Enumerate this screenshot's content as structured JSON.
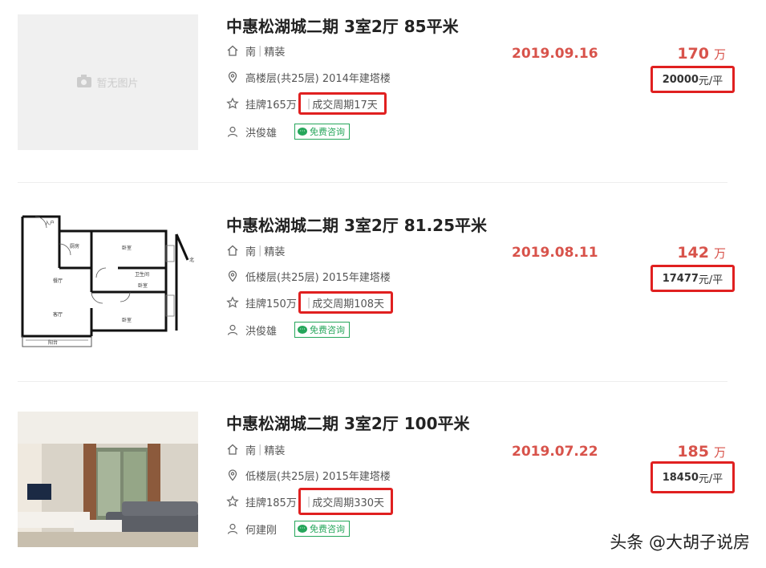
{
  "listings": [
    {
      "title": "中惠松湖城二期 3室2厅 85平米",
      "orientation": "南",
      "decoration": "精装",
      "floor_info": "高楼层(共25层) 2014年建塔楼",
      "listing_price": "挂牌165万",
      "deal_cycle": "成交周期17天",
      "agent": "洪俊雄",
      "consult": "免费咨询",
      "date": "2019.09.16",
      "price": "170",
      "price_unit": "万",
      "unit_price_value": "20000",
      "unit_price_suffix": "元/平",
      "image_placeholder": "暂无图片"
    },
    {
      "title": "中惠松湖城二期 3室2厅 81.25平米",
      "orientation": "南",
      "decoration": "精装",
      "floor_info": "低楼层(共25层) 2015年建塔楼",
      "listing_price": "挂牌150万",
      "deal_cycle": "成交周期108天",
      "agent": "洪俊雄",
      "consult": "免费咨询",
      "date": "2019.08.11",
      "price": "142",
      "price_unit": "万",
      "unit_price_value": "17477",
      "unit_price_suffix": "元/平",
      "floorplan_labels": {
        "entrance": "入户",
        "kitchen": "厨房",
        "bedroom1": "卧室",
        "bathroom": "卫生间",
        "bedroom2": "卧室",
        "dining": "餐厅",
        "living": "客厅",
        "bedroom3": "卧室",
        "balcony": "阳台",
        "north": "北"
      }
    },
    {
      "title": "中惠松湖城二期 3室2厅 100平米",
      "orientation": "南",
      "decoration": "精装",
      "floor_info": "低楼层(共25层) 2015年建塔楼",
      "listing_price": "挂牌185万",
      "deal_cycle": "成交周期330天",
      "agent": "何建刚",
      "consult": "免费咨询",
      "date": "2019.07.22",
      "price": "185",
      "price_unit": "万",
      "unit_price_value": "18450",
      "unit_price_suffix": "元/平"
    }
  ],
  "watermark": "头条 @大胡子说房",
  "colors": {
    "accent_red": "#d8534b",
    "highlight_box": "#e02020",
    "consult_green": "#26a65b"
  },
  "icons": [
    "home-icon",
    "location-icon",
    "star-icon",
    "user-icon",
    "chat-icon",
    "camera-icon"
  ]
}
